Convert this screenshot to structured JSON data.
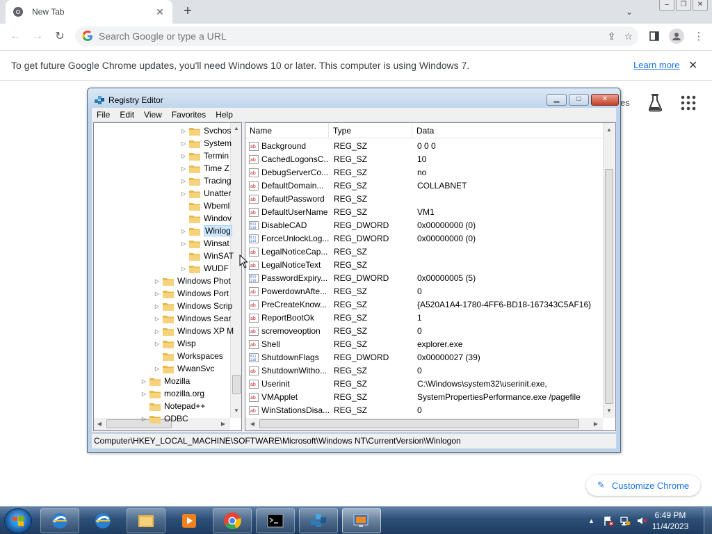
{
  "browser": {
    "tab_title": "New Tab",
    "omnibox_placeholder": "Search Google or type a URL",
    "infobar_message": "To get future Google Chrome updates, you'll need Windows 10 or later. This computer is using Windows 7.",
    "infobar_link": "Learn more",
    "ntp_partial_text": "es",
    "customize_label": "Customize Chrome"
  },
  "registry": {
    "title": "Registry Editor",
    "menu": [
      "File",
      "Edit",
      "View",
      "Favorites",
      "Help"
    ],
    "tree": [
      {
        "label": "Svchos",
        "indent": 2,
        "expandable": true,
        "selected": false
      },
      {
        "label": "System",
        "indent": 2,
        "expandable": true,
        "selected": false
      },
      {
        "label": "Termin",
        "indent": 2,
        "expandable": true,
        "selected": false
      },
      {
        "label": "Time Z",
        "indent": 2,
        "expandable": true,
        "selected": false
      },
      {
        "label": "Tracing",
        "indent": 2,
        "expandable": true,
        "selected": false
      },
      {
        "label": "Unatter",
        "indent": 2,
        "expandable": true,
        "selected": false
      },
      {
        "label": "Wbeml",
        "indent": 2,
        "expandable": false,
        "selected": false
      },
      {
        "label": "Windov",
        "indent": 2,
        "expandable": false,
        "selected": false
      },
      {
        "label": "Winlog",
        "indent": 2,
        "expandable": true,
        "selected": true
      },
      {
        "label": "Winsat",
        "indent": 2,
        "expandable": true,
        "selected": false
      },
      {
        "label": "WinSAT",
        "indent": 2,
        "expandable": false,
        "selected": false
      },
      {
        "label": "WUDF",
        "indent": 2,
        "expandable": true,
        "selected": false
      },
      {
        "label": "Windows Phot",
        "indent": 1,
        "expandable": true,
        "selected": false
      },
      {
        "label": "Windows Port",
        "indent": 1,
        "expandable": true,
        "selected": false
      },
      {
        "label": "Windows Scrip",
        "indent": 1,
        "expandable": true,
        "selected": false
      },
      {
        "label": "Windows Sear",
        "indent": 1,
        "expandable": true,
        "selected": false
      },
      {
        "label": "Windows XP M",
        "indent": 1,
        "expandable": true,
        "selected": false
      },
      {
        "label": "Wisp",
        "indent": 1,
        "expandable": true,
        "selected": false
      },
      {
        "label": "Workspaces",
        "indent": 1,
        "expandable": false,
        "selected": false
      },
      {
        "label": "WwanSvc",
        "indent": 1,
        "expandable": true,
        "selected": false
      },
      {
        "label": "Mozilla",
        "indent": 0,
        "expandable": true,
        "selected": false
      },
      {
        "label": "mozilla.org",
        "indent": 0,
        "expandable": true,
        "selected": false
      },
      {
        "label": "Notepad++",
        "indent": 0,
        "expandable": false,
        "selected": false
      },
      {
        "label": "ODBC",
        "indent": 0,
        "expandable": true,
        "selected": false
      }
    ],
    "columns": {
      "name": "Name",
      "type": "Type",
      "data": "Data"
    },
    "values": [
      {
        "name": "Background",
        "type": "REG_SZ",
        "data": "0 0 0",
        "icon": "string-value-icon"
      },
      {
        "name": "CachedLogonsC...",
        "type": "REG_SZ",
        "data": "10",
        "icon": "string-value-icon"
      },
      {
        "name": "DebugServerCo...",
        "type": "REG_SZ",
        "data": "no",
        "icon": "string-value-icon"
      },
      {
        "name": "DefaultDomain...",
        "type": "REG_SZ",
        "data": "COLLABNET",
        "icon": "string-value-icon"
      },
      {
        "name": "DefaultPassword",
        "type": "REG_SZ",
        "data": "",
        "icon": "string-value-icon"
      },
      {
        "name": "DefaultUserName",
        "type": "REG_SZ",
        "data": "VM1",
        "icon": "string-value-icon"
      },
      {
        "name": "DisableCAD",
        "type": "REG_DWORD",
        "data": "0x00000000 (0)",
        "icon": "binary-value-icon"
      },
      {
        "name": "ForceUnlockLog...",
        "type": "REG_DWORD",
        "data": "0x00000000 (0)",
        "icon": "binary-value-icon"
      },
      {
        "name": "LegalNoticeCap...",
        "type": "REG_SZ",
        "data": "",
        "icon": "string-value-icon"
      },
      {
        "name": "LegalNoticeText",
        "type": "REG_SZ",
        "data": "",
        "icon": "string-value-icon"
      },
      {
        "name": "PasswordExpiry...",
        "type": "REG_DWORD",
        "data": "0x00000005 (5)",
        "icon": "binary-value-icon"
      },
      {
        "name": "PowerdownAfte...",
        "type": "REG_SZ",
        "data": "0",
        "icon": "string-value-icon"
      },
      {
        "name": "PreCreateKnow...",
        "type": "REG_SZ",
        "data": "{A520A1A4-1780-4FF6-BD18-167343C5AF16}",
        "icon": "string-value-icon"
      },
      {
        "name": "ReportBootOk",
        "type": "REG_SZ",
        "data": "1",
        "icon": "string-value-icon"
      },
      {
        "name": "scremoveoption",
        "type": "REG_SZ",
        "data": "0",
        "icon": "string-value-icon"
      },
      {
        "name": "Shell",
        "type": "REG_SZ",
        "data": "explorer.exe",
        "icon": "string-value-icon"
      },
      {
        "name": "ShutdownFlags",
        "type": "REG_DWORD",
        "data": "0x00000027 (39)",
        "icon": "binary-value-icon"
      },
      {
        "name": "ShutdownWitho...",
        "type": "REG_SZ",
        "data": "0",
        "icon": "string-value-icon"
      },
      {
        "name": "Userinit",
        "type": "REG_SZ",
        "data": "C:\\Windows\\system32\\userinit.exe,",
        "icon": "string-value-icon"
      },
      {
        "name": "VMApplet",
        "type": "REG_SZ",
        "data": "SystemPropertiesPerformance.exe /pagefile",
        "icon": "string-value-icon"
      },
      {
        "name": "WinStationsDisa...",
        "type": "REG_SZ",
        "data": "0",
        "icon": "string-value-icon"
      }
    ],
    "status_path": "Computer\\HKEY_LOCAL_MACHINE\\SOFTWARE\\Microsoft\\Windows NT\\CurrentVersion\\Winlogon"
  },
  "taskbar": {
    "apps": [
      {
        "name": "explorer-app-icon",
        "state": "pinned"
      },
      {
        "name": "ie-app-icon",
        "state": "plain"
      },
      {
        "name": "libraries-app-icon",
        "state": "pinned"
      },
      {
        "name": "media-player-app-icon",
        "state": "plain"
      },
      {
        "name": "chrome-app-icon",
        "state": "pinned"
      },
      {
        "name": "cmd-app-icon",
        "state": "pinned"
      },
      {
        "name": "regedit-app-icon",
        "state": "pinned"
      },
      {
        "name": "remote-desktop-app-icon",
        "state": "active"
      }
    ],
    "time": "6:49 PM",
    "date": "11/4/2023"
  },
  "colors": {
    "chrome_accent": "#1a73e8",
    "taskbar": "#2c4f78",
    "registry_frame": "#bcd3ea",
    "selection": "#cde8ff"
  }
}
